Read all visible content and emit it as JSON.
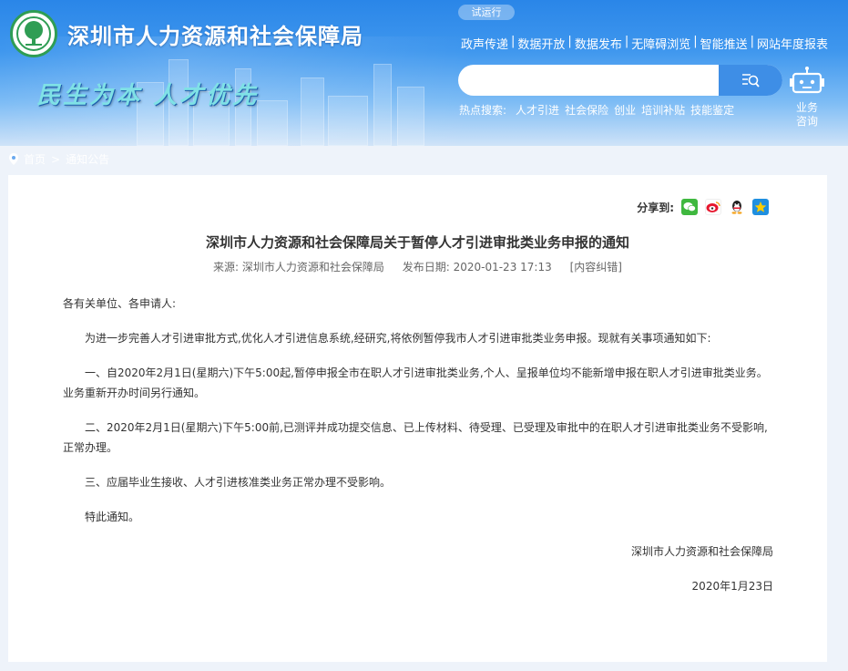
{
  "site": {
    "title": "深圳市人力资源和社会保障局",
    "slogan": "民生为本 人才优先",
    "trial_badge": "试运行"
  },
  "topnav": {
    "items": [
      "政声传递",
      "数据开放",
      "数据发布",
      "无障碍浏览",
      "智能推送",
      "网站年度报表"
    ]
  },
  "search": {
    "placeholder": "",
    "hot_label": "热点搜索:",
    "hot_terms": [
      "人才引进",
      "社会保险",
      "创业",
      "培训补贴",
      "技能鉴定"
    ]
  },
  "consult": {
    "label": "业务咨询"
  },
  "breadcrumb": {
    "home": "首页",
    "separator": ">",
    "current": "通知公告"
  },
  "share": {
    "label": "分享到:",
    "icons": [
      "wechat-icon",
      "weibo-icon",
      "qq-icon",
      "qzone-icon"
    ]
  },
  "article": {
    "title": "深圳市人力资源和社会保障局关于暂停人才引进审批类业务申报的通知",
    "source": "来源: 深圳市人力资源和社会保障局",
    "date": "发布日期: 2020-01-23 17:13",
    "correction": "[内容纠错]",
    "salutation": "各有关单位、各申请人:",
    "intro": "为进一步完善人才引进审批方式,优化人才引进信息系统,经研究,将依例暂停我市人才引进审批类业务申报。现就有关事项通知如下:",
    "item1": "一、自2020年2月1日(星期六)下午5:00起,暂停申报全市在职人才引进审批类业务,个人、呈报单位均不能新增申报在职人才引进审批类业务。业务重新开办时间另行通知。",
    "item2": "二、2020年2月1日(星期六)下午5:00前,已测评并成功提交信息、已上传材料、待受理、已受理及审批中的在职人才引进审批类业务不受影响,正常办理。",
    "item3": "三、应届毕业生接收、人才引进核准类业务正常办理不受影响。",
    "closing": "特此通知。",
    "signature": "深圳市人力资源和社会保障局",
    "sign_date": "2020年1月23日"
  },
  "colors": {
    "header_blue": "#2a86e8",
    "search_button": "#3e8ee6",
    "logo_green": "#2f9d54"
  }
}
